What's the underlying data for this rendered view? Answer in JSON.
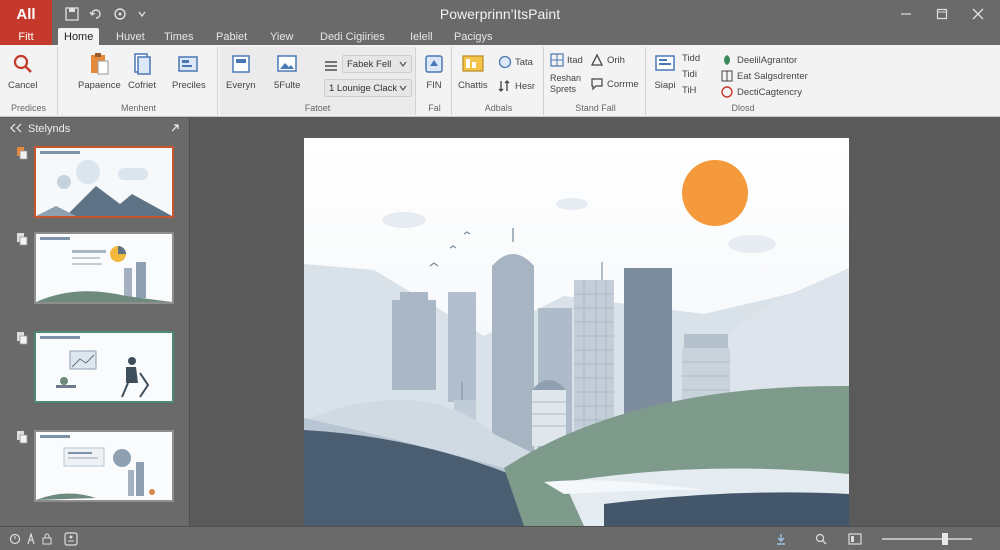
{
  "app": {
    "badge": "All",
    "title": "Powerprinn'ItsPaint"
  },
  "tabs": {
    "file": "Fitt",
    "items": [
      "Home",
      "Huvet",
      "Times",
      "Pabiet",
      "Yiew",
      "Dedi Cigiiries",
      "Ielell",
      "Pacigys"
    ]
  },
  "ribbon": {
    "groups": {
      "clipboard": {
        "label": "Predices",
        "cancel": "Cancel"
      },
      "insert": {
        "label": "Menhent",
        "buttons": [
          "Papaence",
          "Cofriet",
          "Preciles"
        ]
      },
      "format": {
        "label": "Fatoet",
        "everyn": "Everyn",
        "sfute": "5Fulte",
        "font_dropdown": "Fabek Fell",
        "lounge_dropdown": "1 Lounige Clack"
      },
      "fill": {
        "label": "Fal",
        "fin": "FIN"
      },
      "actions": {
        "label": "Adbals",
        "chattis": "Chattis",
        "tata": "Tata",
        "hesr": "Hesr"
      },
      "stand": {
        "label": "Stand Fall",
        "itrad": "Itad",
        "rechan": "Reshan Sprets",
        "orih": "Orih",
        "corrme": "Corrme"
      },
      "closed": {
        "label": "Dlosd",
        "siapi": "Siapi",
        "tidd": "Tidd",
        "tidi": "Tidi",
        "tih": "TiH",
        "dashagrantor": "DeelilAgrantor",
        "sulgsdrenter": "Eat Salgsdrenter",
        "dectigencrery": "DectiCagtencry"
      }
    }
  },
  "panel": {
    "title": "Stelynds",
    "slide_count": 4
  },
  "colors": {
    "accent": "#c5392c",
    "sun": "#f59a3c",
    "selected_border": "#c5562f"
  }
}
